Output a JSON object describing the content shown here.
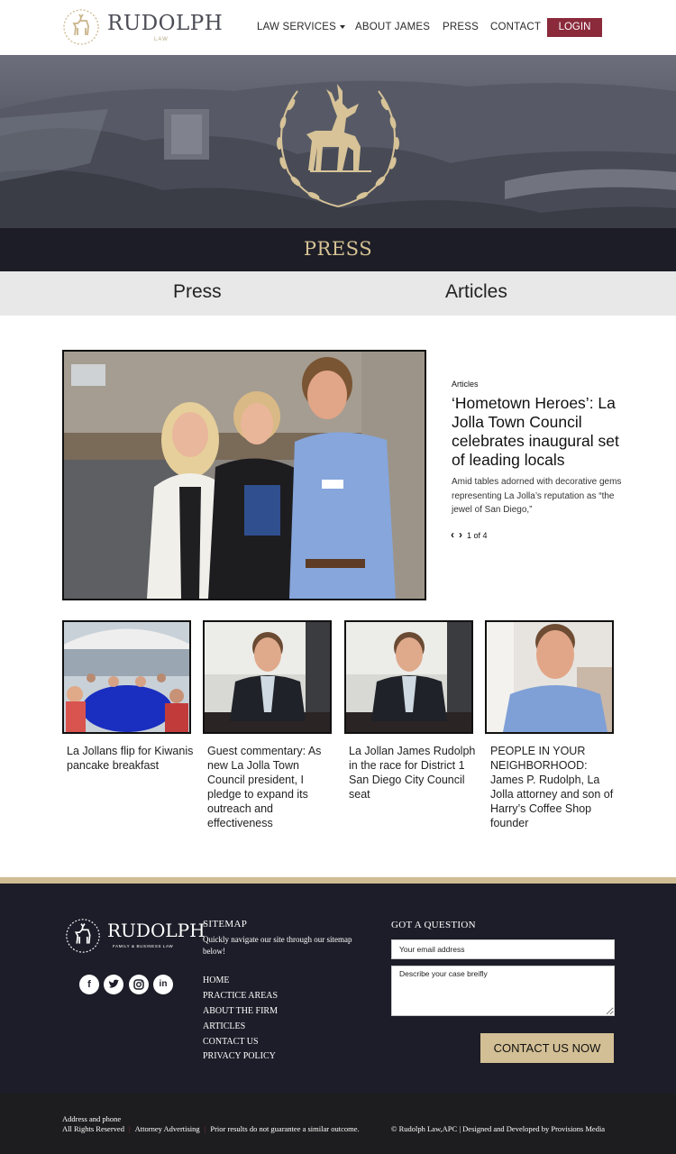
{
  "header": {
    "logo_text": "RUDOLPH",
    "logo_sub": "LAW",
    "nav": [
      "LAW SERVICES",
      "ABOUT JAMES",
      "PRESS",
      "CONTACT"
    ],
    "login_label": "LOGIN"
  },
  "banner": {
    "title": "PRESS"
  },
  "tabs": [
    "Press",
    "Articles"
  ],
  "featured": {
    "category": "Articles",
    "title": "‘Hometown Heroes’: La Jolla Town Council celebrates inaugural set of leading locals",
    "description": "Amid tables adorned with decorative gems representing La Jolla’s reputation as “the jewel of San Diego,”",
    "pager": "1 of 4"
  },
  "cards": [
    {
      "title": "La Jollans flip for Kiwanis pancake breakfast"
    },
    {
      "title": "Guest commentary: As new La Jolla Town Council president, I pledge to expand its outreach and effectiveness"
    },
    {
      "title": "La Jollan James Rudolph in the race for District 1 San Diego City Council seat"
    },
    {
      "title": "PEOPLE IN YOUR NEIGHBORHOOD: James P. Rudolph, La Jolla attorney and son of Harry’s Coffee Shop founder"
    }
  ],
  "footer": {
    "logo_text": "RUDOLPH",
    "logo_sub": "FAMILY & BUSINESS LAW",
    "social_icons": [
      "facebook-icon",
      "twitter-icon",
      "instagram-icon",
      "linkedin-icon"
    ],
    "sitemap": {
      "heading": "SITEMAP",
      "description": "Quickly navigate our site through our sitemap below!",
      "links": [
        "HOME",
        "PRACTICE AREAS",
        "ABOUT THE FIRM",
        "ARTICLES",
        "CONTACT US",
        "PRIVACY POLICY"
      ]
    },
    "question": {
      "heading": "GOT A QUESTION",
      "email_placeholder": "Your email address",
      "case_placeholder": "Describe your case breifly",
      "button_label": "CONTACT US NOW"
    }
  },
  "bottom": {
    "address": "Address and phone",
    "rights": "All Rights Reserved",
    "advertising": "Attorney Advertising",
    "disclaimer": "Prior results do not guarantee a similar outcome.",
    "credits": "© Rudolph Law,APC | Designed and Developed by Provisions Media"
  },
  "colors": {
    "brand_gold": "#d3bf95",
    "login_maroon": "#8a2a3b",
    "footer_navy": "#1c1d28"
  }
}
